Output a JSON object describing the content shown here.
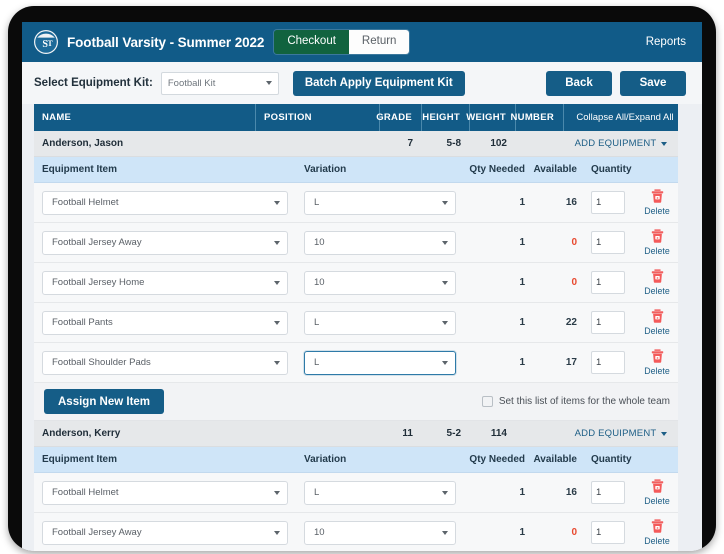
{
  "header": {
    "logo_icon": "st-circle-logo",
    "title": "Football Varsity - Summer 2022",
    "checkout_label": "Checkout",
    "return_label": "Return",
    "reports_label": "Reports"
  },
  "toolbar": {
    "kit_label": "Select Equipment Kit:",
    "kit_value": "Football Kit",
    "batch_label": "Batch Apply Equipment Kit",
    "back_label": "Back",
    "save_label": "Save"
  },
  "roster_columns": {
    "name": "NAME",
    "position": "POSITION",
    "grade": "GRADE",
    "height": "HEIGHT",
    "weight": "WEIGHT",
    "number": "NUMBER",
    "collapse": "Collapse All/Expand All"
  },
  "equipment_columns": {
    "item": "Equipment Item",
    "variation": "Variation",
    "qty_needed": "Qty Needed",
    "available": "Available",
    "quantity": "Quantity",
    "delete": ""
  },
  "labels": {
    "add_equipment": "ADD EQUIPMENT",
    "assign_new_item": "Assign New Item",
    "set_whole_team": "Set this list of items for the whole team",
    "delete": "Delete"
  },
  "colors": {
    "brand_blue": "#125b87",
    "checkout_green": "#11633f",
    "header_row_blue": "#cfe5f8",
    "zero_red": "#e8492f",
    "delete_icon_red": "#f45f5f"
  },
  "players": [
    {
      "name": "Anderson, Jason",
      "position": "",
      "grade": "7",
      "height": "5-8",
      "weight": "102",
      "number": "",
      "items": [
        {
          "item": "Football Helmet",
          "variation": "L",
          "qty_needed": "1",
          "available": "16",
          "quantity": "1",
          "available_zero": false,
          "variation_focused": false
        },
        {
          "item": "Football Jersey Away",
          "variation": "10",
          "qty_needed": "1",
          "available": "0",
          "quantity": "1",
          "available_zero": true,
          "variation_focused": false
        },
        {
          "item": "Football Jersey Home",
          "variation": "10",
          "qty_needed": "1",
          "available": "0",
          "quantity": "1",
          "available_zero": true,
          "variation_focused": false
        },
        {
          "item": "Football Pants",
          "variation": "L",
          "qty_needed": "1",
          "available": "22",
          "quantity": "1",
          "available_zero": false,
          "variation_focused": false
        },
        {
          "item": "Football Shoulder Pads",
          "variation": "L",
          "qty_needed": "1",
          "available": "17",
          "quantity": "1",
          "available_zero": false,
          "variation_focused": true
        }
      ]
    },
    {
      "name": "Anderson, Kerry",
      "position": "",
      "grade": "11",
      "height": "5-2",
      "weight": "114",
      "number": "",
      "items": [
        {
          "item": "Football Helmet",
          "variation": "L",
          "qty_needed": "1",
          "available": "16",
          "quantity": "1",
          "available_zero": false,
          "variation_focused": false
        },
        {
          "item": "Football Jersey Away",
          "variation": "10",
          "qty_needed": "1",
          "available": "0",
          "quantity": "1",
          "available_zero": true,
          "variation_focused": false
        }
      ]
    }
  ]
}
